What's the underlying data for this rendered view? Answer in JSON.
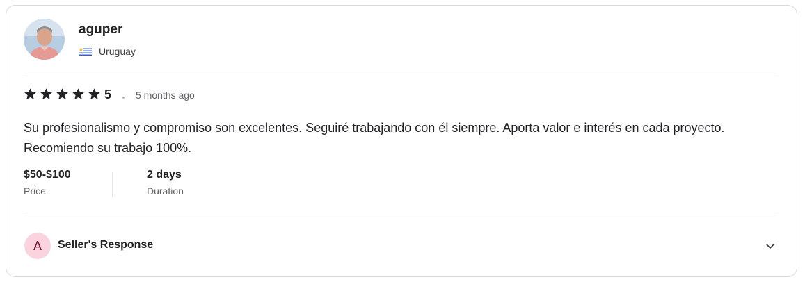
{
  "reviewer": {
    "username": "aguper",
    "country": "Uruguay",
    "avatar_icon": "user-photo-avatar",
    "flag_icon": "uruguay-flag-icon"
  },
  "rating": {
    "value": "5",
    "stars": 5,
    "time_ago": "5 months ago"
  },
  "review": {
    "text": "Su profesionalismo y compromiso son excelentes. Seguiré trabajando con él siempre. Aporta valor e interés en cada proyecto. Recomiendo su trabajo 100%."
  },
  "stats": {
    "price_value": "$50-$100",
    "price_label": "Price",
    "duration_value": "2 days",
    "duration_label": "Duration"
  },
  "seller_response": {
    "initial": "A",
    "label": "Seller's Response",
    "expand_icon": "chevron-down-icon"
  },
  "colors": {
    "star": "#222325",
    "seller_avatar_bg": "#fbd3df",
    "seller_avatar_text": "#74112f",
    "divider": "#e4e5e7"
  }
}
